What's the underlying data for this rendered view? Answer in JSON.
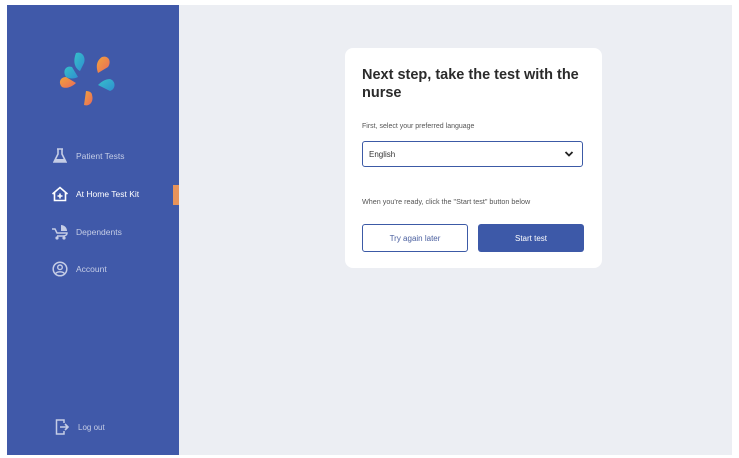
{
  "sidebar": {
    "logo": "star-logo",
    "items": [
      {
        "label": "Patient Tests",
        "icon": "flask-icon",
        "active": false
      },
      {
        "label": "At Home Test Kit",
        "icon": "home-plus-icon",
        "active": true
      },
      {
        "label": "Dependents",
        "icon": "stroller-icon",
        "active": false
      },
      {
        "label": "Account",
        "icon": "user-circle-icon",
        "active": false
      }
    ],
    "logout": {
      "label": "Log out",
      "icon": "logout-icon"
    }
  },
  "card": {
    "title": "Next step, take the test with the nurse",
    "language_label": "First, select your preferred language",
    "language_select": {
      "value": "English"
    },
    "ready_text": "When you're ready, click the \"Start test\" button below",
    "try_later_label": "Try again later",
    "start_label": "Start test"
  },
  "colors": {
    "sidebar": "#4059a9",
    "background": "#eceef3",
    "primary": "#3d59a8",
    "active_indicator": "#e8935a"
  }
}
